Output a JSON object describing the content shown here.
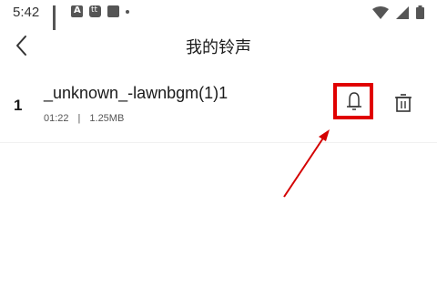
{
  "status_bar": {
    "time": "5:42",
    "left_icons": [
      "grid-icon",
      "app-a-icon",
      "app-tt-icon",
      "square-icon",
      "dot-icon"
    ],
    "right_icons": [
      "wifi-icon",
      "signal-icon",
      "battery-icon"
    ]
  },
  "header": {
    "title": "我的铃声",
    "back_icon": "chevron-left-icon"
  },
  "ringtones": [
    {
      "index": "1",
      "title": "_unknown_-lawnbgm(1)1",
      "duration": "01:22",
      "separator": "|",
      "size": "1.25MB"
    }
  ],
  "colors": {
    "highlight": "#e00000",
    "arrow": "#d40000"
  }
}
